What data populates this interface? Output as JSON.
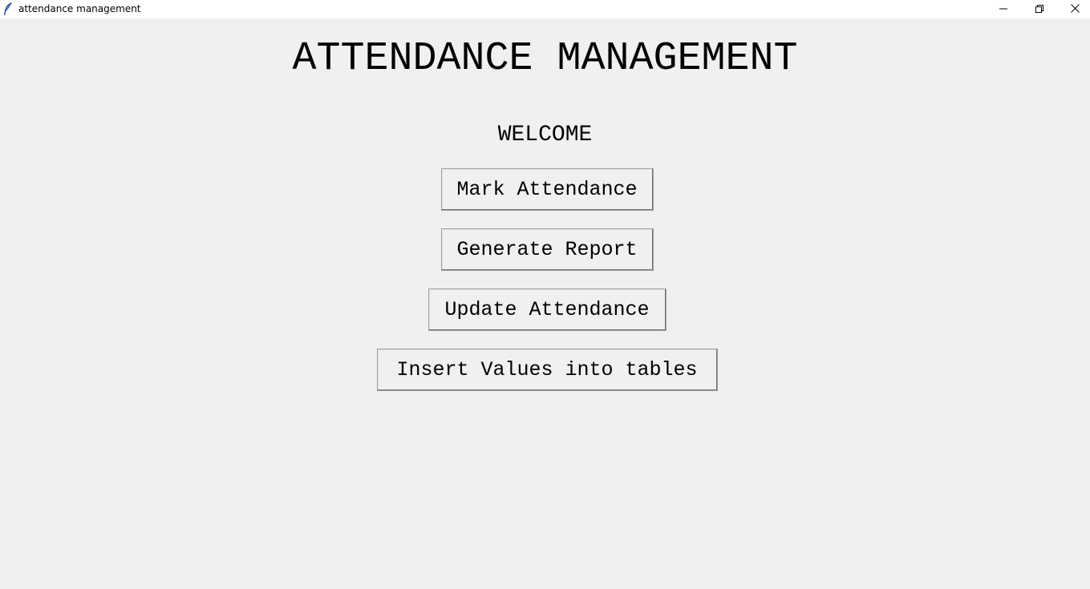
{
  "window": {
    "title": "attendance management",
    "icon": "feather-icon",
    "controls": {
      "minimize": "minimize-icon",
      "maximize": "restore-icon",
      "close": "close-icon"
    }
  },
  "main": {
    "heading": "ATTENDANCE MANAGEMENT",
    "welcome": "WELCOME",
    "buttons": [
      {
        "label": "Mark Attendance"
      },
      {
        "label": "Generate Report"
      },
      {
        "label": "Update Attendance"
      },
      {
        "label": "Insert Values into tables"
      }
    ]
  },
  "colors": {
    "background": "#f0f0f0",
    "titlebar": "#ffffff",
    "text": "#000000"
  }
}
